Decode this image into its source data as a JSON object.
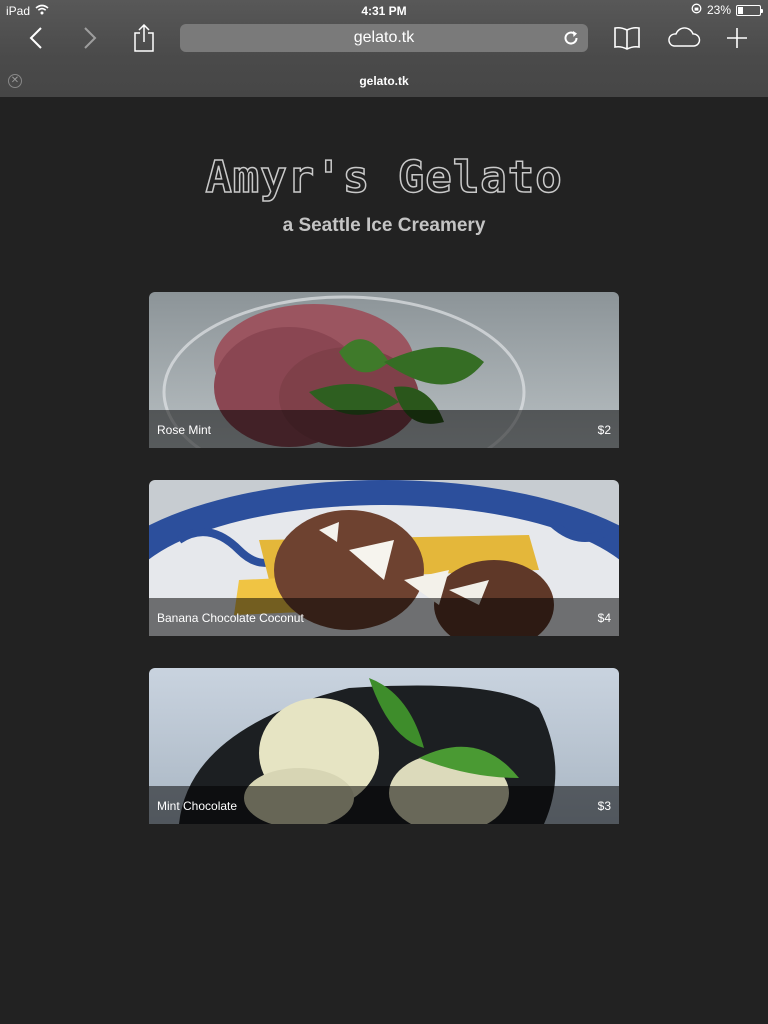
{
  "status": {
    "device": "iPad",
    "time": "4:31 PM",
    "battery_percent": 23,
    "battery_text": "23%"
  },
  "browser": {
    "url": "gelato.tk",
    "tab_title": "gelato.tk"
  },
  "page": {
    "title": "Amyr's Gelato",
    "subtitle": "a Seattle Ice Creamery",
    "items": [
      {
        "name": "Rose Mint",
        "price": "$2"
      },
      {
        "name": "Banana Chocolate Coconut",
        "price": "$4"
      },
      {
        "name": "Mint Chocolate",
        "price": "$3"
      }
    ]
  },
  "colors": {
    "background": "#222222",
    "chrome": "#4a4a4a"
  },
  "icons": [
    "wifi-icon",
    "rotation-lock-icon",
    "battery-icon",
    "back-icon",
    "forward-icon",
    "share-icon",
    "reload-icon",
    "bookmarks-icon",
    "icloud-tabs-icon",
    "new-tab-icon",
    "close-tab-icon"
  ]
}
